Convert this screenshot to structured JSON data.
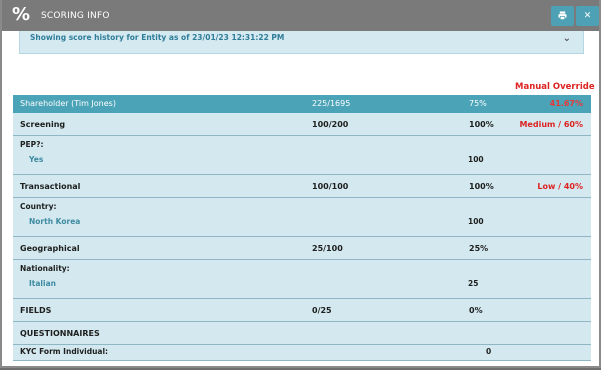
{
  "header": {
    "title": "SCORING INFO",
    "logo_glyph": "%",
    "print_icon": "printer-icon",
    "close_icon": "close-icon",
    "colors": {
      "header_bg": "#7a7a7a",
      "button_bg": "#4ea1b4"
    }
  },
  "info": {
    "text": "Showing score history for Entity as of 23/01/23 12:31:22 PM"
  },
  "override_label": "Manual Override",
  "summary": {
    "name": "Shareholder (Tim Jones)",
    "score": "225/1695",
    "percent": "75%",
    "override": "41.67%"
  },
  "sections": {
    "screening": {
      "name": "Screening",
      "score": "100/200",
      "percent": "100%",
      "risk": "Medium / 60%"
    },
    "pep_label": "PEP?:",
    "pep_value": "Yes",
    "pep_points": "100",
    "transactional": {
      "name": "Transactional",
      "score": "100/100",
      "percent": "100%",
      "risk": "Low / 40%"
    },
    "country_label": "Country:",
    "country_value": "North Korea",
    "country_points": "100",
    "geographical": {
      "name": "Geographical",
      "score": "25/100",
      "percent": "25%"
    },
    "nationality_label": "Nationality:",
    "nationality_value": "Italian",
    "nationality_points": "25",
    "fields": {
      "name": "FIELDS",
      "score": "0/25",
      "percent": "0%"
    },
    "questionnaires": {
      "name": "QUESTIONNAIRES"
    },
    "kyc_label": "KYC Form Individual:",
    "kyc_points": "0"
  }
}
